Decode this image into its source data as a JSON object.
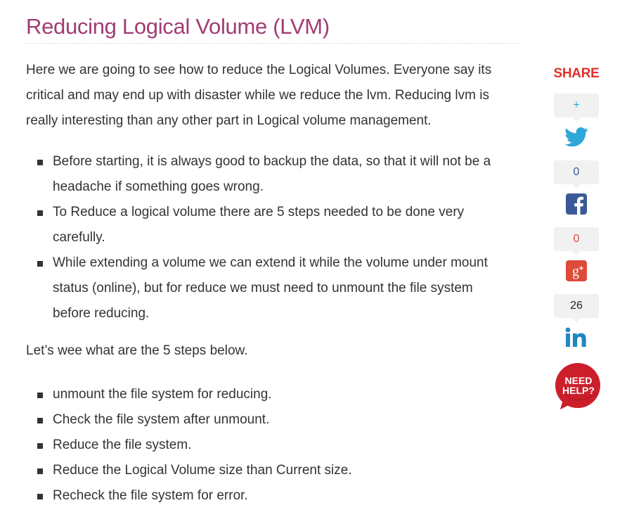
{
  "article": {
    "title": "Reducing Logical Volume (LVM)",
    "intro": "Here we are going to see how to reduce the Logical Volumes. Everyone say its critical and may end up with disaster while we reduce the lvm. Reducing lvm is really interesting than any other part in Logical volume management.",
    "notes": [
      "Before starting, it is always good to backup the data, so that it will not be a headache if something goes wrong.",
      "To Reduce a logical volume there are 5 steps needed to be done very carefully.",
      "While extending a volume we can extend it while the volume under mount status (online), but for reduce we must need to unmount the file system before reducing."
    ],
    "steps_intro": "Let’s wee what are the 5 steps below.",
    "steps": [
      "unmount the file system for reducing.",
      "Check the file system after unmount.",
      "Reduce the file system.",
      "Reduce the Logical Volume size than Current size.",
      "Recheck the file system for error."
    ]
  },
  "share": {
    "title": "SHARE",
    "counters": [
      {
        "id": "twitter",
        "value": "+",
        "color": "#2fa6d8",
        "icon": "twitter-icon"
      },
      {
        "id": "facebook",
        "value": "0",
        "color": "#3b5998",
        "icon": "facebook-icon"
      },
      {
        "id": "googleplus",
        "value": "0",
        "color": "#dd4b39",
        "icon": "google-plus-icon"
      },
      {
        "id": "linkedin",
        "value": "26",
        "color": "#222222",
        "icon": "linkedin-icon"
      }
    ],
    "need_help": {
      "line1": "NEED",
      "line2": "HELP?",
      "color": "#cc1f2b"
    }
  }
}
